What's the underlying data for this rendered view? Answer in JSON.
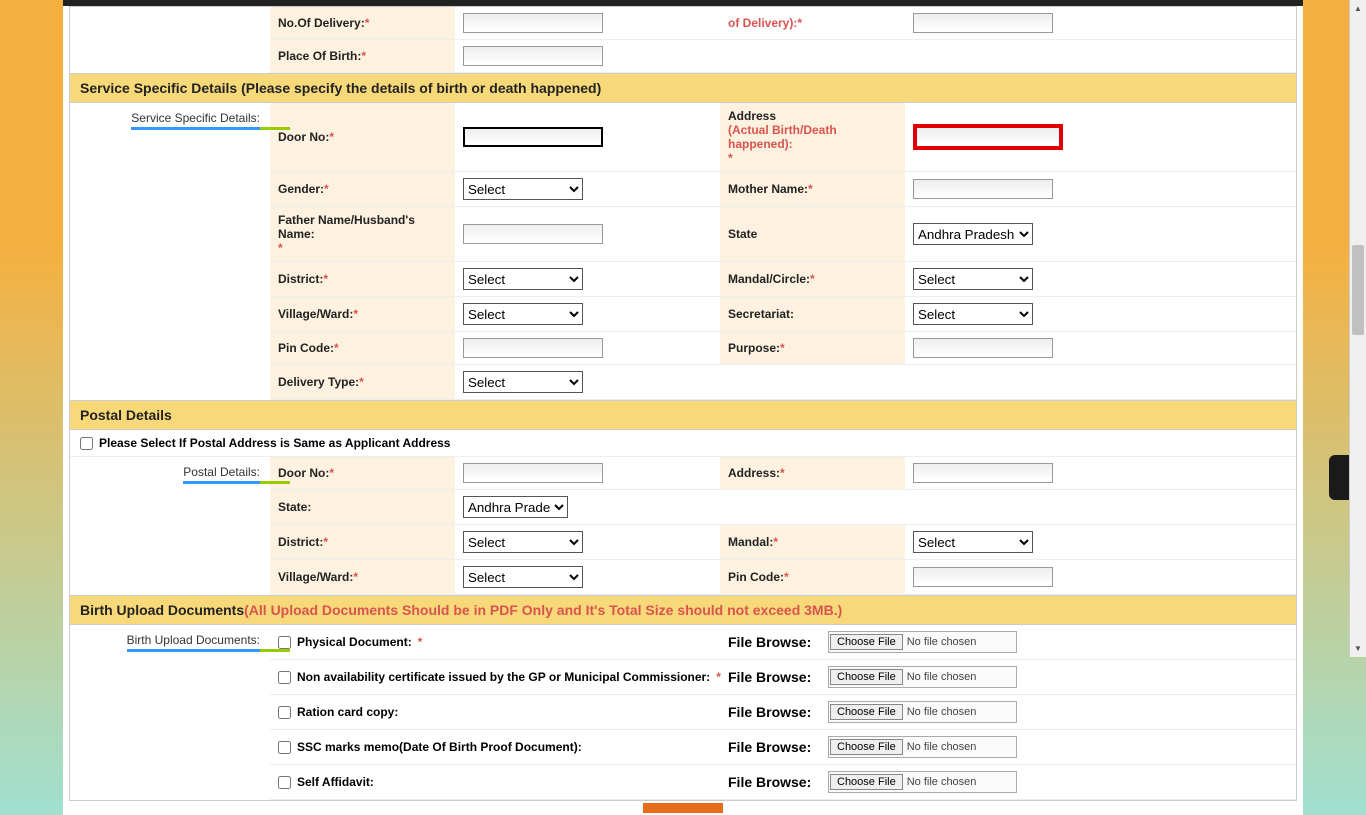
{
  "top_rows": {
    "no_delivery": {
      "label": "No.Of Delivery:",
      "req": "*"
    },
    "related": {
      "label": "of Delivery):",
      "req": "*"
    },
    "place_birth": {
      "label": "Place Of Birth:",
      "req": "*"
    }
  },
  "service_header": "Service Specific Details (Please specify the details of birth or death happened)",
  "service_side": "Service Specific Details:",
  "service": {
    "door_no": {
      "label": "Door No:",
      "req": "*"
    },
    "address": {
      "label": "Address",
      "note": "(Actual Birth/Death happened):",
      "req": "*"
    },
    "gender": {
      "label": "Gender:",
      "req": "*",
      "sel": "Select"
    },
    "mother": {
      "label": "Mother Name:",
      "req": "*"
    },
    "father": {
      "label": "Father Name/Husband's Name:",
      "req": "*"
    },
    "state": {
      "label": "State",
      "sel": "Andhra Pradesh"
    },
    "district": {
      "label": "District:",
      "req": "*",
      "sel": "Select"
    },
    "mandal": {
      "label": "Mandal/Circle:",
      "req": "*",
      "sel": "Select"
    },
    "village": {
      "label": "Village/Ward:",
      "req": "*",
      "sel": "Select"
    },
    "secretariat": {
      "label": "Secretariat:",
      "sel": "Select"
    },
    "pin": {
      "label": "Pin Code:",
      "req": "*"
    },
    "purpose": {
      "label": "Purpose:",
      "req": "*"
    },
    "delivery_type": {
      "label": "Delivery Type:",
      "req": "*",
      "sel": "Select"
    }
  },
  "postal_header": "Postal Details",
  "postal_check": "Please Select If Postal Address is Same as Applicant Address",
  "postal_side": "Postal Details:",
  "postal": {
    "door_no": {
      "label": "Door No:",
      "req": "*"
    },
    "address": {
      "label": "Address:",
      "req": "*"
    },
    "state": {
      "label": "State:",
      "sel": "Andhra Pradesh"
    },
    "district": {
      "label": "District:",
      "req": "*",
      "sel": "Select"
    },
    "mandal": {
      "label": "Mandal:",
      "req": "*",
      "sel": "Select"
    },
    "village": {
      "label": "Village/Ward:",
      "req": "*",
      "sel": "Select"
    },
    "pin": {
      "label": "Pin Code:",
      "req": "*"
    }
  },
  "docs_header": "Birth Upload Documents",
  "docs_note": "(All Upload Documents Should be in PDF Only and It's Total Size should not exceed 3MB.)",
  "docs_side": "Birth Upload Documents:",
  "file_browse": "File Browse:",
  "choose_file": "Choose File",
  "no_file": "No file chosen",
  "docs": [
    {
      "label": "Physical Document:",
      "req": "*"
    },
    {
      "label": "Non availability certificate issued by the GP or Municipal Commissioner:",
      "req": "*"
    },
    {
      "label": "Ration card copy:"
    },
    {
      "label": "SSC marks memo(Date Of Birth Proof Document):"
    },
    {
      "label": "Self Affidavit:"
    }
  ]
}
